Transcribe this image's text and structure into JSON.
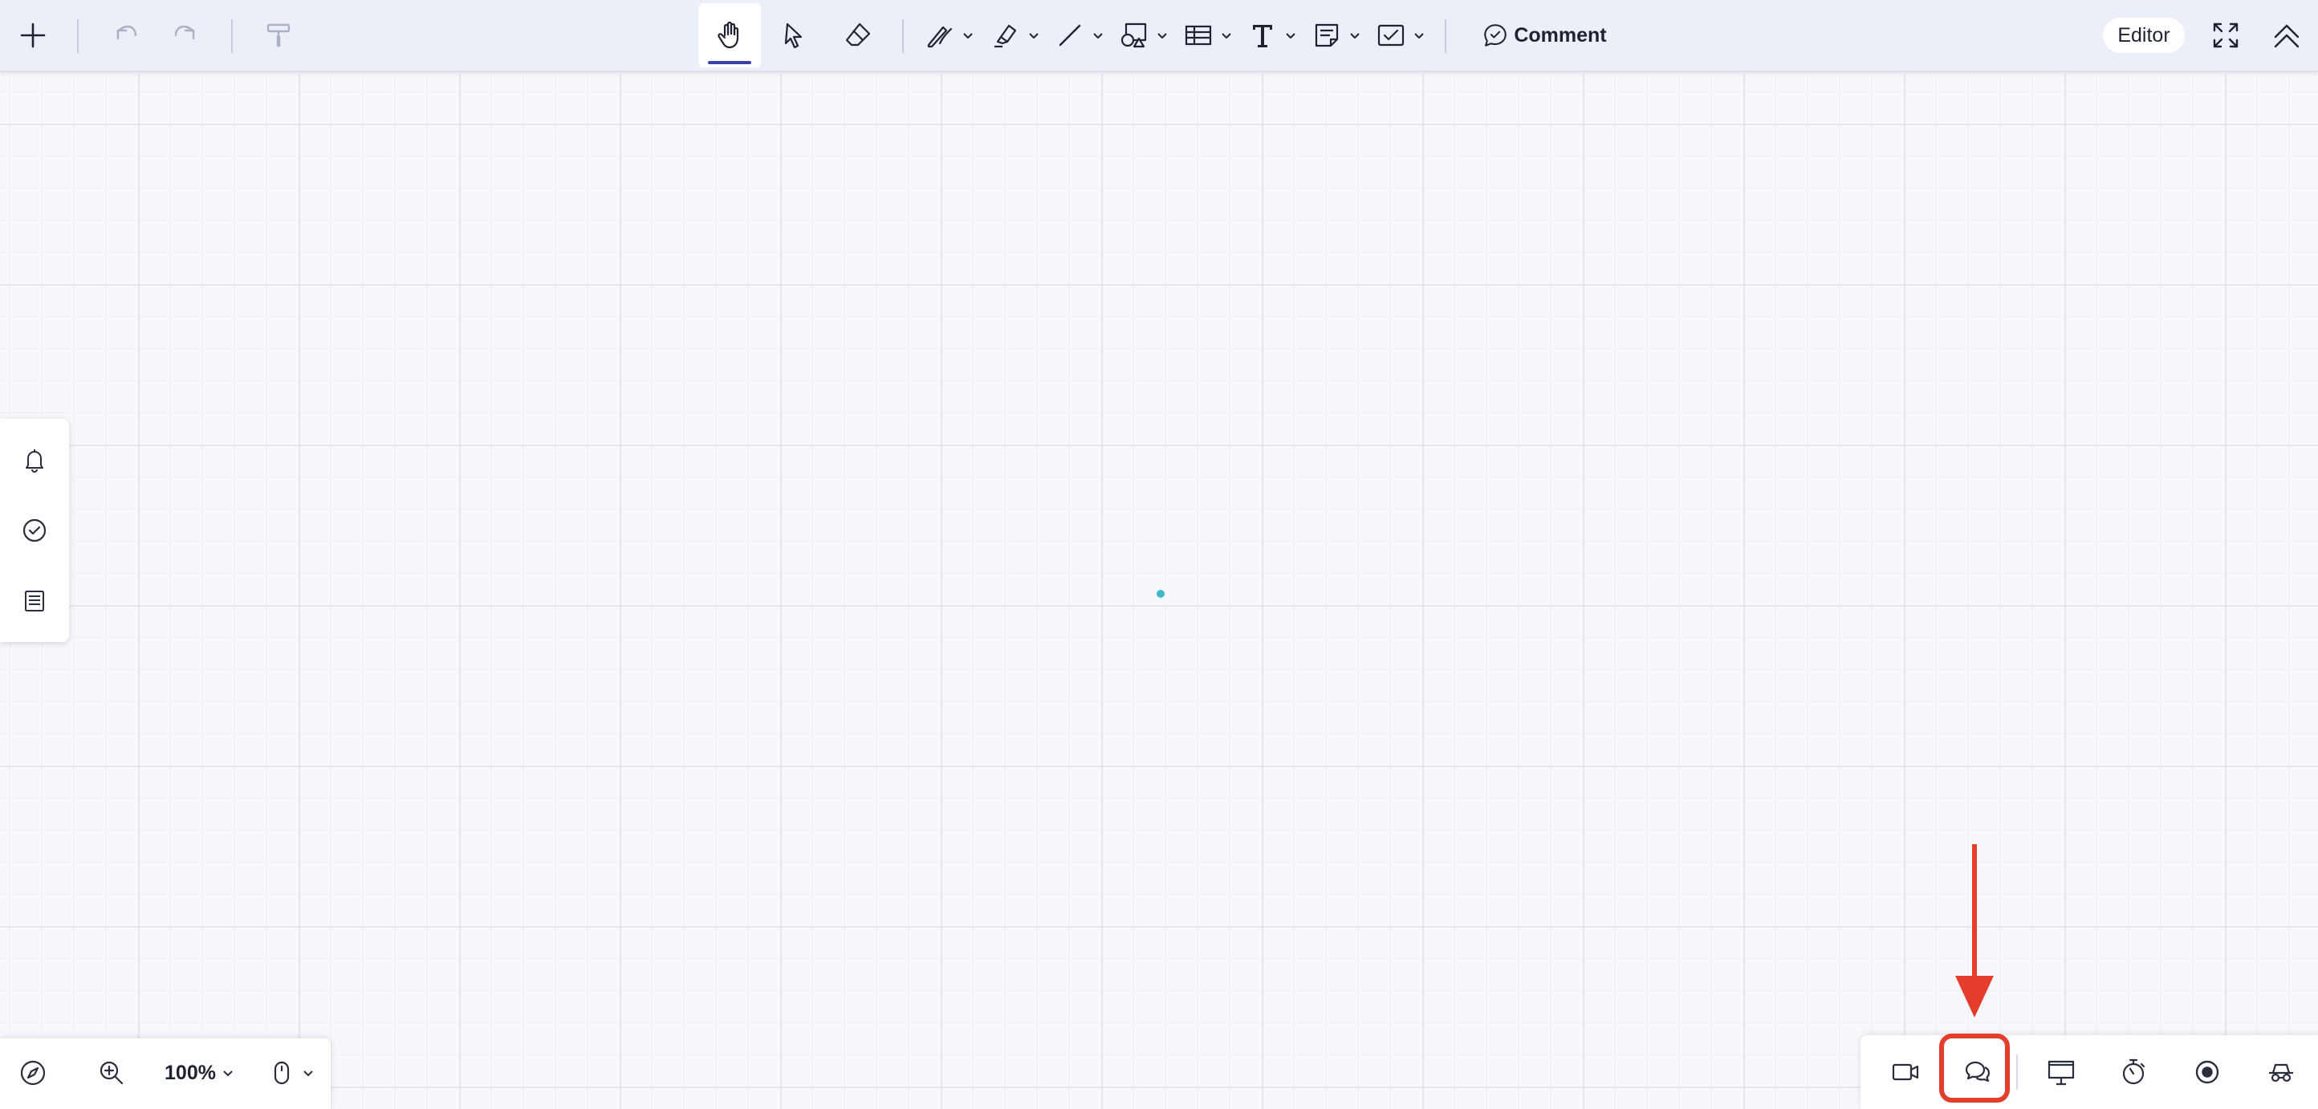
{
  "toolbar": {
    "comment_label": "Comment",
    "role_label": "Editor",
    "tools": {
      "add": "plus-icon",
      "undo": "undo-icon",
      "redo": "redo-icon",
      "format_painter": "paint-roller-icon",
      "hand": "hand-icon",
      "select": "pointer-icon",
      "eraser": "eraser-icon",
      "pen": "pen-icon",
      "highlighter": "highlighter-icon",
      "line": "line-icon",
      "shapes": "shapes-icon",
      "table": "table-icon",
      "text": "text-icon",
      "sticky_note": "sticky-note-icon",
      "checklist": "checkbox-icon",
      "comment": "comment-icon",
      "fullscreen": "expand-icon",
      "collapse": "collapse-up-icon"
    },
    "active_tool": "hand"
  },
  "left_rail": {
    "items": [
      "bell-icon",
      "check-circle-icon",
      "list-icon"
    ]
  },
  "zoom_bar": {
    "zoom_level": "100%",
    "items": [
      "compass-icon",
      "zoom-in-icon",
      "mouse-icon"
    ]
  },
  "collab_bar": {
    "items": [
      "video-icon",
      "chat-icon",
      "present-icon",
      "timer-icon",
      "record-icon",
      "incognito-icon"
    ],
    "highlighted_item": "chat-icon"
  },
  "colors": {
    "accent": "#3b3fa8",
    "annotation": "#e53d2b",
    "canvas_dot": "#3fb8c9",
    "canvas_bg": "#f7f8fc"
  }
}
